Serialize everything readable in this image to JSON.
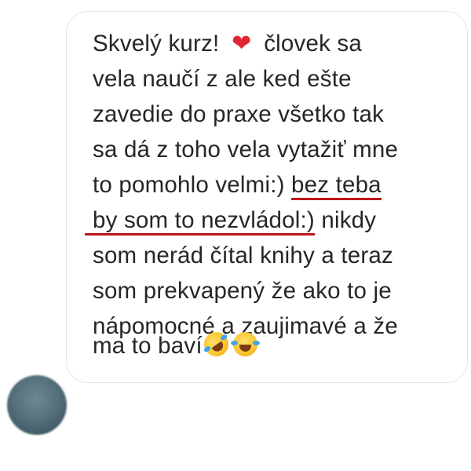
{
  "message": {
    "lines": [
      {
        "before": "Skvelý kurz! ",
        "heart": "❤",
        "after": " človek sa"
      },
      {
        "text": "vela naučí z ale ked ešte"
      },
      {
        "text": "zavedie do praxe všetko tak"
      },
      {
        "text": "sa dá z toho vela vytažiť mne"
      },
      {
        "before": "to pomohlo velmi:) ",
        "underlined": "bez teba"
      },
      {
        "underlined": "by som to nezvládol:)",
        "after": " nikdy"
      },
      {
        "text": "som nerád čítal knihy a teraz"
      },
      {
        "text": "som prekvapený že ako to je"
      },
      {
        "text": "nápomocné a zaujimavé a že"
      },
      {
        "before": "ma to baví"
      }
    ],
    "emojis": [
      "rolling-on-floor-laughing-emoji",
      "face-with-tears-of-joy-emoji"
    ],
    "underline_color": "#c0141c",
    "text_color": "#262626"
  },
  "avatar": {
    "state": "blurred"
  }
}
